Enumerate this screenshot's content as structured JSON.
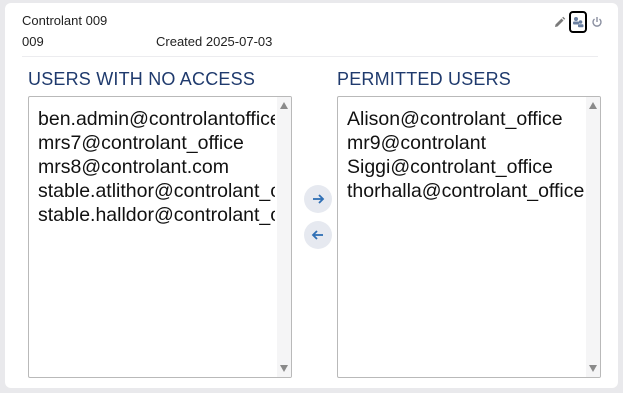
{
  "header": {
    "title": "Controlant 009",
    "id": "009",
    "created": "Created 2025-07-03",
    "actions": [
      "pencil-icon",
      "users-icon",
      "power-icon"
    ]
  },
  "no_access": {
    "title": "USERS WITH NO ACCESS",
    "items": [
      "ben.admin@controlantoffice",
      "mrs7@controlant_office",
      "mrs8@controlant.com",
      "stable.atlithor@controlant_office",
      "stable.halldor@controlant_office"
    ]
  },
  "permitted": {
    "title": "PERMITTED USERS",
    "items": [
      "Alison@controlant_office",
      "mr9@controlant",
      "Siggi@controlant_office",
      "thorhalla@controlant_office"
    ]
  },
  "colors": {
    "title": "#1f3a6d",
    "accent": "#2f6fb5",
    "button_bg": "#e6e9f0"
  }
}
